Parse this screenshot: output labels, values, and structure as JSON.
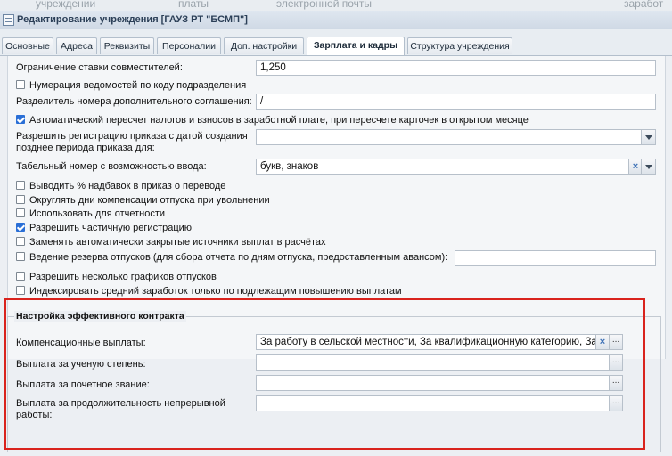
{
  "background_strip": [
    "учреждении",
    "платы",
    "электронной почты",
    "заработ"
  ],
  "window": {
    "title": "Редактирование учреждения [ГАУЗ РТ \"БСМП\"]"
  },
  "tabs": [
    "Основные",
    "Адреса",
    "Реквизиты",
    "Персоналии",
    "Доп. настройки",
    "Зарплата и кадры",
    "Структура учреждения"
  ],
  "active_tab": "Зарплата и кадры",
  "form": {
    "limit_label": "Ограничение ставки совместителей:",
    "limit_value": "1,250",
    "numbering_label": "Нумерация ведомостей по коду подразделения",
    "separator_label": "Разделитель номера дополнительного соглашения:",
    "separator_value": "/",
    "recalc_label": "Автоматический пересчет налогов и взносов в заработной плате, при пересчете карточек в открытом месяце",
    "allow_reg_label_1": "Разрешить регистрацию приказа с датой создания",
    "allow_reg_label_2": "позднее периода приказа для:",
    "tabnum_label": "Табельный номер с возможностью ввода:",
    "tabnum_value": "букв, знаков",
    "chk1": "Выводить % надбавок в приказ о переводе",
    "chk2": "Округлять дни компенсации отпуска при увольнении",
    "chk3": "Использовать для отчетности",
    "chk4": "Разрешить частичную регистрацию",
    "chk5": "Заменять автоматически закрытые источники выплат в расчётах",
    "chk6": "Ведение резерва отпусков (для сбора отчета по дням отпуска, предоставленным авансом):",
    "chk7": "Разрешить несколько графиков отпусков",
    "chk8": "Индексировать средний заработок только по подлежащим повышению выплатам"
  },
  "contract": {
    "legend": "Настройка эффективного контракта",
    "comp_label": "Компенсационные выплаты:",
    "comp_value": "За работу в сельской местности, За квалификационную категорию, За стаж",
    "degree_label": "Выплата за ученую степень:",
    "title_label": "Выплата за почетное звание:",
    "duration_label_1": "Выплата за продолжительность непрерывной",
    "duration_label_2": "работы:"
  }
}
